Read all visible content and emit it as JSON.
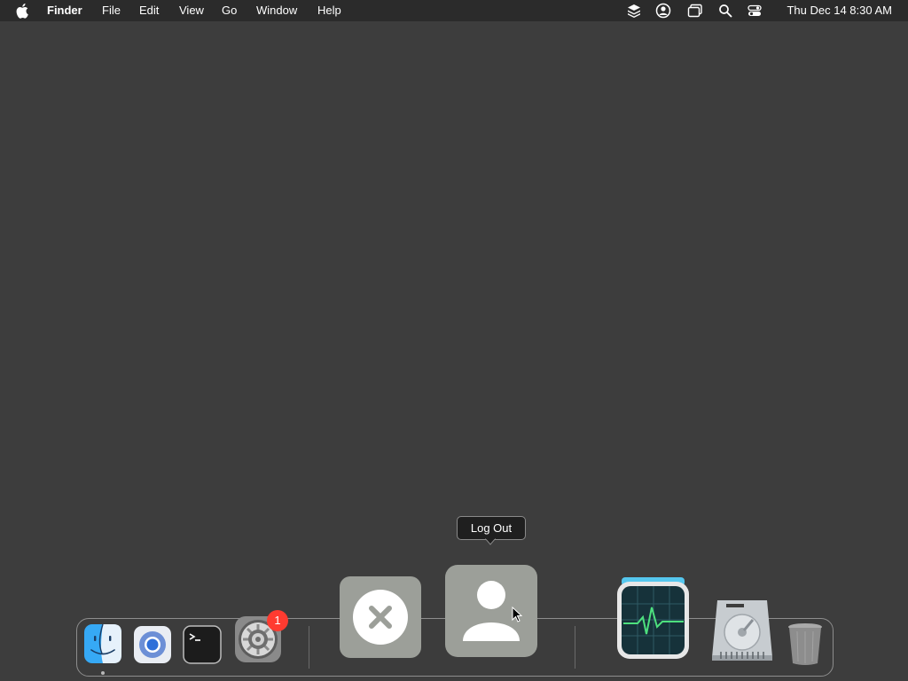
{
  "menubar": {
    "app_name": "Finder",
    "menus": [
      "File",
      "Edit",
      "View",
      "Go",
      "Window",
      "Help"
    ],
    "status_icons": [
      "layers-icon",
      "user-account-icon",
      "screen-mirroring-icon",
      "spotlight-search-icon",
      "control-center-icon"
    ],
    "clock": "Thu Dec 14  8:30 AM"
  },
  "tooltip": {
    "label": "Log Out"
  },
  "dock": {
    "apps": [
      {
        "name": "Finder",
        "icon": "finder-icon",
        "running": true
      },
      {
        "name": "Chromium",
        "icon": "chromium-icon",
        "running": false
      },
      {
        "name": "Terminal",
        "icon": "terminal-icon",
        "running": false
      },
      {
        "name": "System Preferences",
        "icon": "gear-icon",
        "running": false,
        "badge": "1"
      },
      {
        "name": "Cancel",
        "icon": "close-icon",
        "running": false
      },
      {
        "name": "Log Out",
        "icon": "user-icon",
        "running": false
      },
      {
        "name": "Activity Monitor",
        "icon": "activity-monitor-icon",
        "running": false
      },
      {
        "name": "Disk",
        "icon": "hard-drive-icon",
        "running": false
      },
      {
        "name": "Trash",
        "icon": "trash-icon",
        "running": false
      }
    ]
  },
  "colors": {
    "desktop": "#3d3d3d",
    "menubar": "#2b2b2b",
    "badge": "#ff3b30"
  }
}
